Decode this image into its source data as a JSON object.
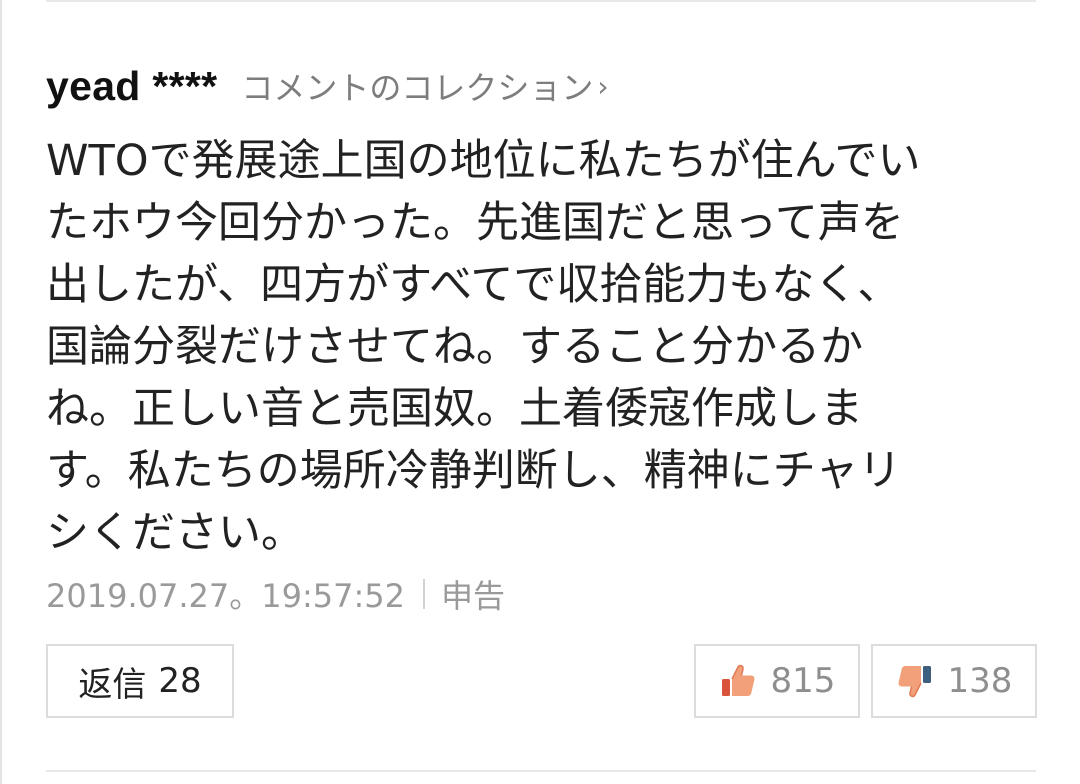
{
  "comment": {
    "username": "yead ****",
    "collection_link": "コメントのコレクション",
    "lines": [
      "WTOで発展途上国の地位に私たちが住んでい",
      "たホウ今回分かった。先進国だと思って声を",
      "出したが、四方がすべてで収拾能力もなく、",
      "国論分裂だけさせてね。すること分かるか",
      "ね。正しい音と売国奴。土着倭寇作成しま",
      "す。私たちの場所冷静判断し、精神にチャリ",
      "シください。"
    ],
    "timestamp": "2019.07.27。19:57:52",
    "report_label": "申告"
  },
  "actions": {
    "reply_label": "返信",
    "reply_count": "28",
    "like_count": "815",
    "dislike_count": "138"
  },
  "icons": {
    "chevron": "chevron-right-icon",
    "like": "thumbs-up-icon",
    "dislike": "thumbs-down-icon"
  },
  "colors": {
    "text": "#222222",
    "muted": "#9a9a9a",
    "like_accent": "#f08a5d",
    "dislike_accent": "#4a6b8a"
  }
}
